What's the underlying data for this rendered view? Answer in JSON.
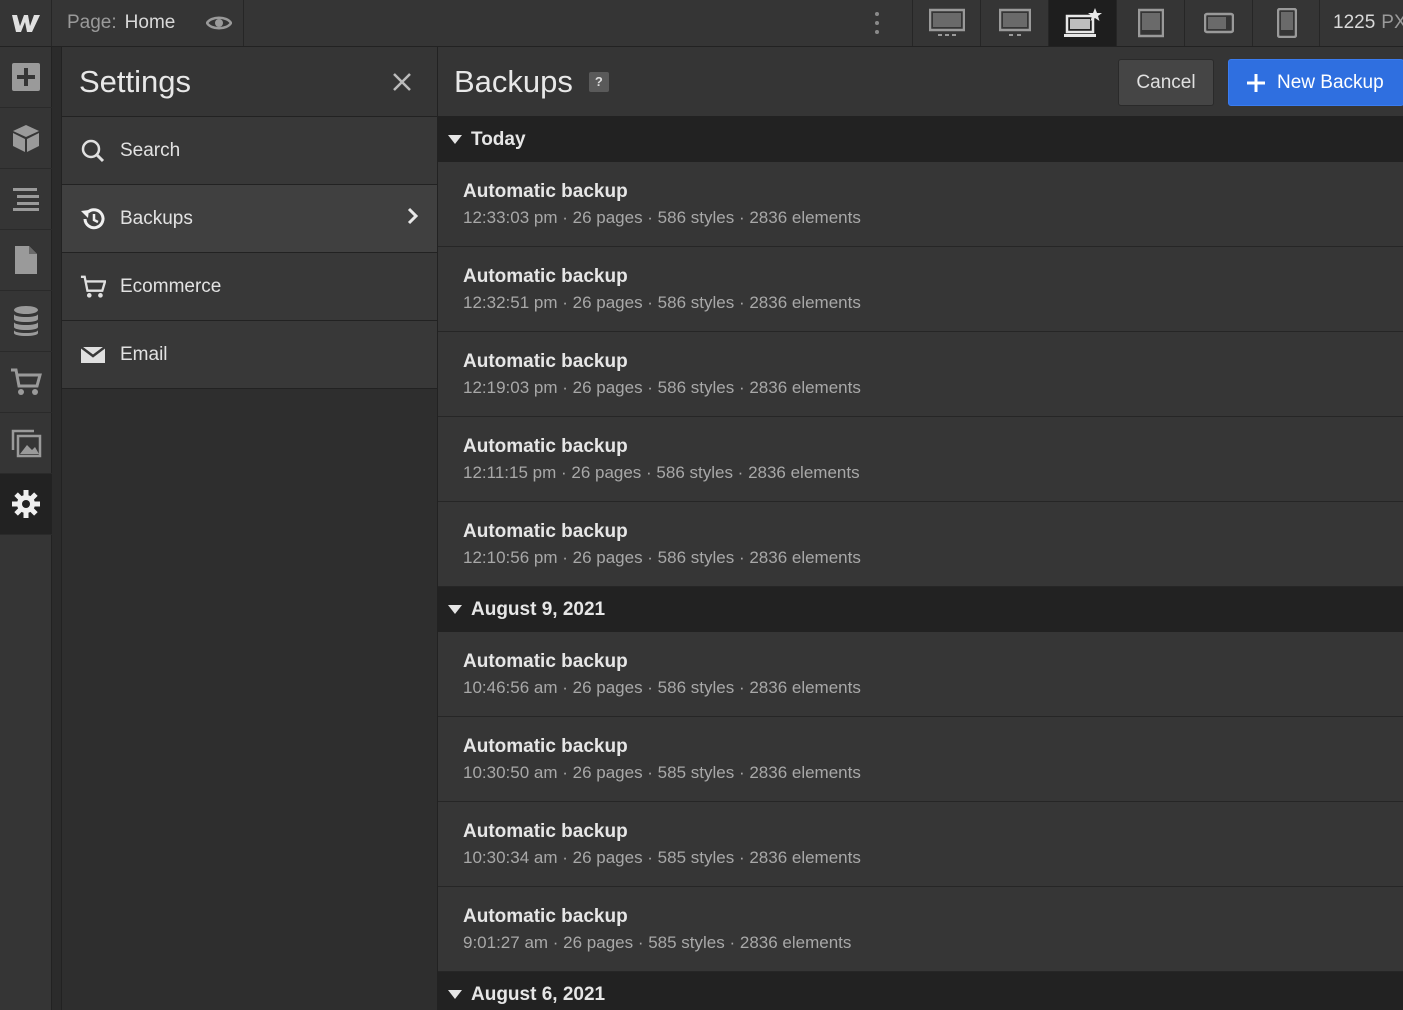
{
  "topbar": {
    "page_key": "Page:",
    "page_value": "Home",
    "width_value": "1225",
    "width_unit": "PX"
  },
  "rail": {
    "items": [
      "add-icon",
      "cube-icon",
      "navigator-icon",
      "pages-icon",
      "cms-icon",
      "ecommerce-icon",
      "assets-icon",
      "settings-icon"
    ]
  },
  "settings": {
    "title": "Settings",
    "items": [
      {
        "label": "Search",
        "icon": "search-icon"
      },
      {
        "label": "Backups",
        "icon": "history-icon"
      },
      {
        "label": "Ecommerce",
        "icon": "cart-icon"
      },
      {
        "label": "Email",
        "icon": "envelope-icon"
      }
    ]
  },
  "backups": {
    "title": "Backups",
    "help": "?",
    "cancel_label": "Cancel",
    "new_label": "New Backup",
    "groups": [
      {
        "title": "Today",
        "rows": [
          {
            "name": "Automatic backup",
            "meta": "12:33:03 pm · 26 pages · 586 styles · 2836 elements"
          },
          {
            "name": "Automatic backup",
            "meta": "12:32:51 pm · 26 pages · 586 styles · 2836 elements"
          },
          {
            "name": "Automatic backup",
            "meta": "12:19:03 pm · 26 pages · 586 styles · 2836 elements"
          },
          {
            "name": "Automatic backup",
            "meta": "12:11:15 pm · 26 pages · 586 styles · 2836 elements"
          },
          {
            "name": "Automatic backup",
            "meta": "12:10:56 pm · 26 pages · 586 styles · 2836 elements"
          }
        ]
      },
      {
        "title": "August 9, 2021",
        "rows": [
          {
            "name": "Automatic backup",
            "meta": "10:46:56 am · 26 pages · 586 styles · 2836 elements"
          },
          {
            "name": "Automatic backup",
            "meta": "10:30:50 am · 26 pages · 585 styles · 2836 elements"
          },
          {
            "name": "Automatic backup",
            "meta": "10:30:34 am · 26 pages · 585 styles · 2836 elements"
          },
          {
            "name": "Automatic backup",
            "meta": "9:01:27 am · 26 pages · 585 styles · 2836 elements"
          }
        ]
      },
      {
        "title": "August 6, 2021",
        "rows": []
      }
    ]
  },
  "colors": {
    "accent": "#2f6fe0",
    "panel": "#353535",
    "group_header": "#222222"
  }
}
